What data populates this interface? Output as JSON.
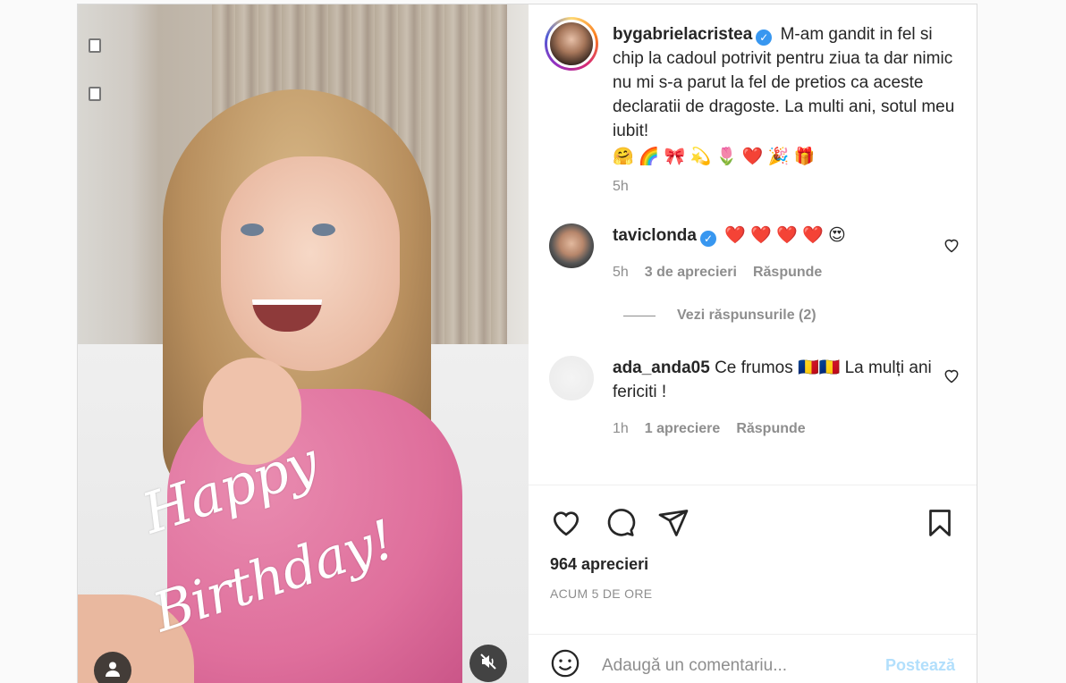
{
  "caption": {
    "username": "bygabrielacristea",
    "verified": true,
    "text": "M-am gandit in fel si chip la cadoul potrivit pentru ziua ta dar nimic nu mi s-a parut la fel de pretios ca aceste declaratii de dragoste. La multi ani, sotul meu iubit!",
    "emojis": "🤗 🌈 🎀 💫 🌷 ❤️ 🎉 🎁",
    "time": "5h"
  },
  "comments": [
    {
      "username": "taviclonda",
      "verified": true,
      "text": "❤️ ❤️ ❤️ ❤️ 😍",
      "time": "5h",
      "likes": "3 de aprecieri",
      "reply": "Răspunde",
      "view_replies": "Vezi răspunsurile (2)"
    },
    {
      "username": "ada_anda05",
      "verified": false,
      "text": "Ce frumos 🇷🇴🇷🇴 La mulți ani fericiti !",
      "time": "1h",
      "likes": "1 apreciere",
      "reply": "Răspunde"
    }
  ],
  "media": {
    "overlay_text_1": "Happy",
    "overlay_text_2": "Birthday!"
  },
  "footer": {
    "likes": "964 aprecieri",
    "posted": "ACUM 5 DE ORE",
    "comment_placeholder": "Adaugă un comentariu...",
    "post_button": "Postează"
  },
  "icons": {
    "like": "heart-icon",
    "comment": "comment-bubble-icon",
    "share": "paper-plane-icon",
    "save": "bookmark-icon",
    "emoji": "smiley-icon",
    "tags": "user-tag-icon",
    "mute": "muted-speaker-icon"
  },
  "colors": {
    "verified": "#3897f0",
    "post_button_disabled": "#b2dffc",
    "muted_text": "#8e8e8e"
  }
}
